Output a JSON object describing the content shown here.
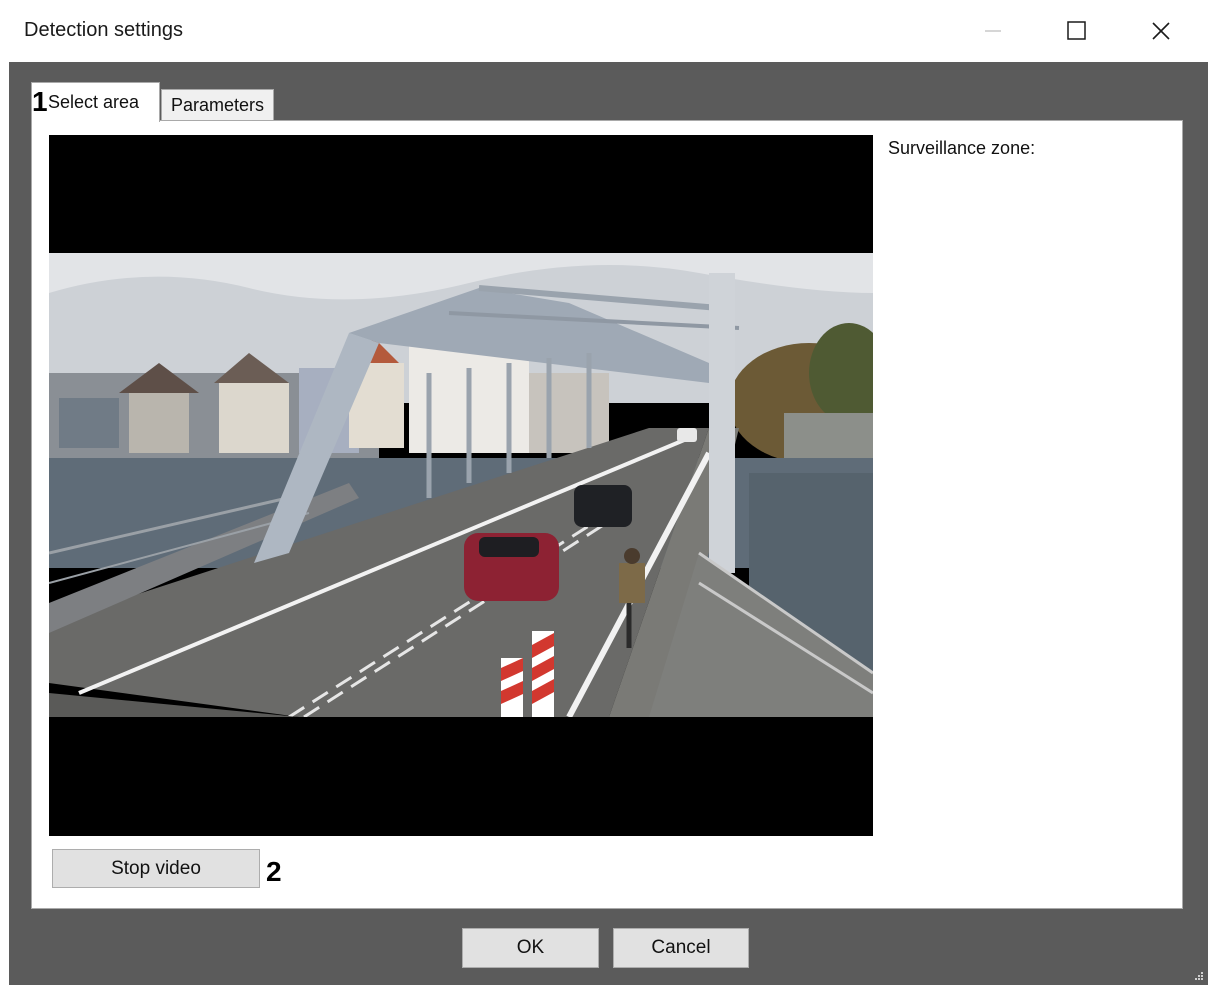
{
  "window": {
    "title": "Detection settings",
    "controls": {
      "minimize": "minimize-icon",
      "maximize": "maximize-icon",
      "close": "close-icon"
    }
  },
  "tabs": [
    {
      "label": "Select area",
      "active": true
    },
    {
      "label": "Parameters",
      "active": false
    }
  ],
  "annotations": {
    "marker_1": "1",
    "marker_2": "2"
  },
  "panel": {
    "zone_label": "Surveillance zone:",
    "stop_button": "Stop video"
  },
  "footer": {
    "ok_label": "OK",
    "cancel_label": "Cancel"
  },
  "colors": {
    "client_background": "#5b5b5b",
    "button_face": "#e1e1e1",
    "video_background": "#000000"
  }
}
